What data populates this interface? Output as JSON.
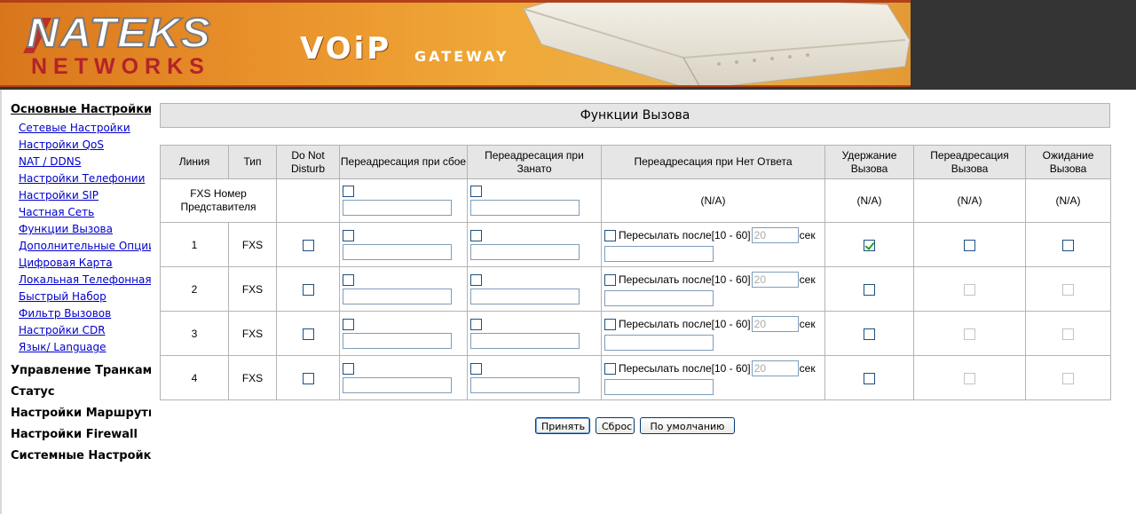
{
  "header": {
    "logo_top": "NATEKS",
    "logo_bottom": "NETWORKS",
    "product": "VOiP",
    "product_sub": "GATEWAY"
  },
  "sidebar": {
    "section_main": "Основные Настройки",
    "items": [
      "Сетевые Настройки",
      "Настройки QoS",
      "NAT / DDNS",
      "Настройки Телефонии",
      "Настройки SIP",
      "Частная Сеть",
      "Функции Вызова",
      "Дополнительные Опции",
      "Цифровая Карта",
      "Локальная Телефонная К",
      "Быстрый Набор",
      "Фильтр Вызовов",
      "Настройки CDR",
      "Язык/ Language"
    ],
    "sections": [
      "Управление Транкам",
      "Статус",
      "Настройки Маршрути",
      "Настройки Firewall",
      "Системные Настройк"
    ]
  },
  "page_title": "Функции Вызова",
  "table": {
    "headers": [
      "Линия",
      "Тип",
      "Do Not Disturb",
      "Переадресация при сбое",
      "Переадресация при Занато",
      "Переадресация при Нет Ответа",
      "Удержание Вызова",
      "Переадресация Вызова",
      "Ожидание Вызова"
    ],
    "rep_row": {
      "line": "FXS Номер Представителя",
      "na_noanswer": "(N/A)",
      "na_hold": "(N/A)",
      "na_transfer": "(N/A)",
      "na_waiting": "(N/A)"
    },
    "forward_label": "Пересылать после[10 - 60]",
    "seconds_unit": "сек",
    "seconds_value": "20",
    "rows": [
      {
        "line": "1",
        "type": "FXS",
        "hold_checked": true
      },
      {
        "line": "2",
        "type": "FXS",
        "hold_checked": false
      },
      {
        "line": "3",
        "type": "FXS",
        "hold_checked": false
      },
      {
        "line": "4",
        "type": "FXS",
        "hold_checked": false
      }
    ]
  },
  "buttons": {
    "apply": "Принять",
    "reset": "Сброс",
    "defaults": "По умолчанию"
  }
}
